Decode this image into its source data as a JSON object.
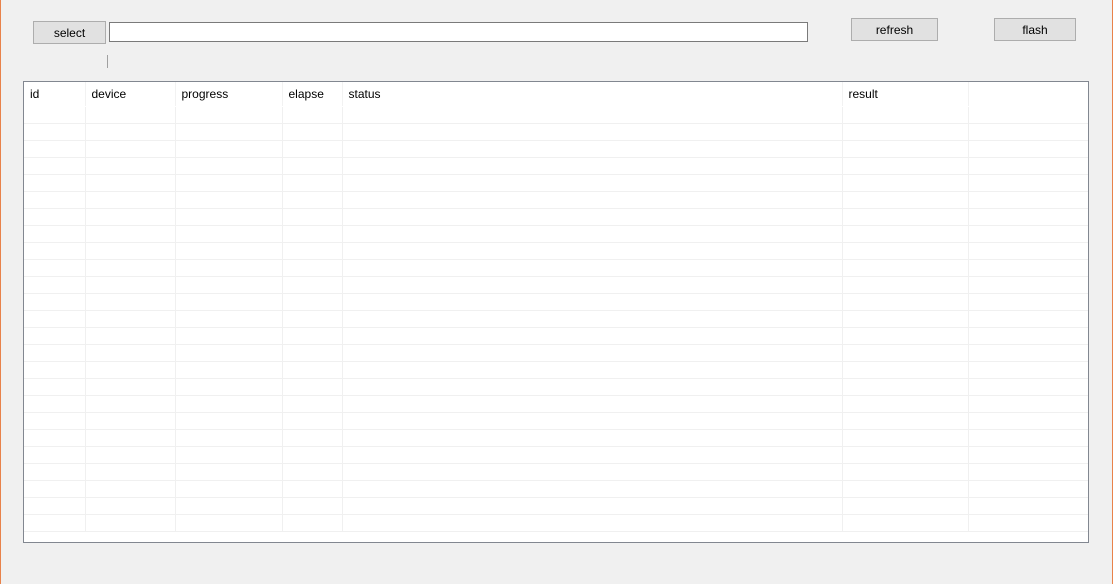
{
  "toolbar": {
    "select_label": "select",
    "path_value": "",
    "refresh_label": "refresh",
    "flash_label": "flash"
  },
  "table": {
    "columns": [
      {
        "key": "id",
        "label": "id"
      },
      {
        "key": "device",
        "label": "device"
      },
      {
        "key": "progress",
        "label": "progress"
      },
      {
        "key": "elapse",
        "label": "elapse"
      },
      {
        "key": "status",
        "label": "status"
      },
      {
        "key": "result",
        "label": "result"
      },
      {
        "key": "extra",
        "label": ""
      }
    ],
    "rows": []
  }
}
